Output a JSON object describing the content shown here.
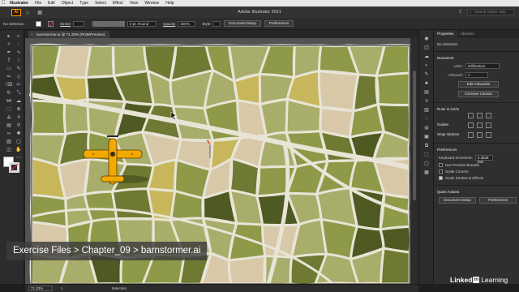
{
  "menubar": {
    "apple": "",
    "items": [
      "Illustrator",
      "File",
      "Edit",
      "Object",
      "Type",
      "Select",
      "Effect",
      "View",
      "Window",
      "Help"
    ]
  },
  "appbar": {
    "logo": "Ai",
    "title": "Adobe Illustrator 2021",
    "search_placeholder": "Search Adobe Help"
  },
  "controlbar": {
    "selection": "No Selection",
    "stroke_label": "Stroke",
    "stroke_value": "3 pt. Round",
    "opacity_label": "Opacity",
    "opacity_value": "100%",
    "style_label": "Style",
    "doc_setup": "Document Setup",
    "preferences": "Preferences"
  },
  "doctab": {
    "close": "×",
    "label": "barnstormer.ai @ 71.33% (RGB/Preview)"
  },
  "toolbar": {
    "icons": [
      "selection-icon",
      "direct-selection-icon",
      "magic-wand-icon",
      "lasso-icon",
      "pen-icon",
      "curvature-icon",
      "type-icon",
      "line-icon",
      "rectangle-icon",
      "paintbrush-icon",
      "pencil-icon",
      "shaper-icon",
      "eraser-icon",
      "scissors-icon",
      "rotate-icon",
      "scale-icon",
      "width-icon",
      "warp-icon",
      "free-transform-icon",
      "shape-builder-icon",
      "perspective-icon",
      "mesh-icon",
      "gradient-icon",
      "eyedropper-icon",
      "blend-icon",
      "symbol-sprayer-icon",
      "graph-icon",
      "artboard-icon",
      "slice-icon",
      "hand-icon",
      "zoom-icon",
      "more-tools-icon"
    ]
  },
  "panel": {
    "tab_properties": "Properties",
    "tab_libraries": "Libraries",
    "no_selection": "No Selection",
    "document": "Document",
    "units_label": "Units:",
    "units_value": "Millimeters",
    "artboard_label": "Artboard:",
    "artboard_value": "1",
    "edit_artboards": "Edit Artboards",
    "increase_canvas": "Increase Canvas",
    "rulers_grids": "Ruler & Grids",
    "guides": "Guides",
    "snap_options": "Snap Options",
    "preferences_title": "Preferences",
    "keyboard_increment_label": "Keyboard Increment:",
    "keyboard_increment_value": "0.3528 mm",
    "use_preview_bounds": "Use Preview Bounds",
    "scale_corners": "Scale Corners",
    "scale_strokes": "Scale Strokes & Effects",
    "quick_actions": "Quick Actions",
    "doc_setup": "Document Setup",
    "preferences": "Preferences"
  },
  "statusbar": {
    "zoom": "71.33%",
    "page": "1",
    "tool": "Selection"
  },
  "caption": "Exercise Files > Chapter_09 > barnstormer.ai",
  "brand": {
    "linked": "Linked",
    "in": "in",
    "learning": "Learning"
  },
  "colors": {
    "field_dark": "#6f7a32",
    "field_olive": "#8f9a49",
    "field_light": "#a9ae6b",
    "field_tan": "#d9c9a9",
    "field_yellow": "#c9b75c",
    "field_deep": "#4f5a22",
    "road": "#e9e6d7",
    "plane": "#f2a900"
  }
}
